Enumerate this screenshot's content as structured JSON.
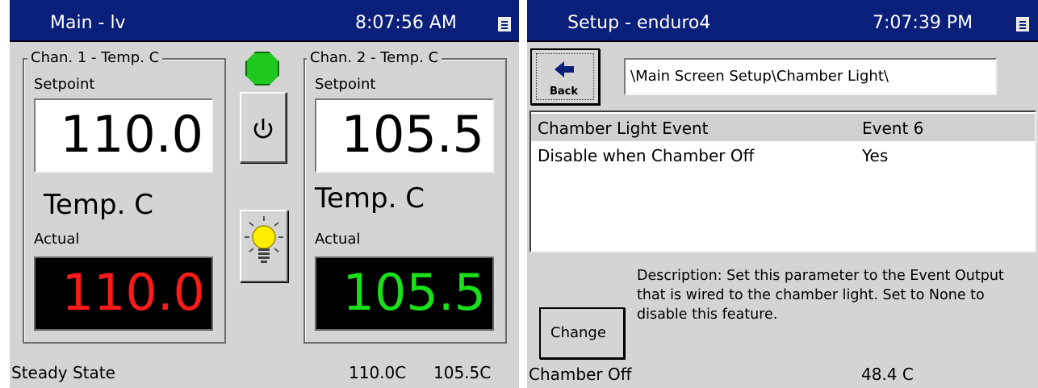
{
  "left_window": {
    "title": "Main - lv",
    "time": "8:07:56 AM",
    "menu_icon": "menu-list-icon",
    "channel1": {
      "group_label": "Chan. 1 - Temp. C",
      "setpoint_label": "Setpoint",
      "setpoint_value": "110.0",
      "units": "Temp. C",
      "actual_label": "Actual",
      "actual_value": "110.0",
      "actual_color": "#ff1a1a"
    },
    "channel2": {
      "group_label": "Chan. 2 - Temp. C",
      "setpoint_label": "Setpoint",
      "setpoint_value": "105.5",
      "units": "Temp. C",
      "actual_label": "Actual",
      "actual_value": "105.5",
      "actual_color": "#19e019"
    },
    "status_indicator_color": "#1ec81e",
    "power_icon": "power-icon",
    "light_icon": "light-bulb-icon",
    "status_bar": {
      "state": "Steady State",
      "chan1": "110.0C",
      "chan2": "105.5C"
    }
  },
  "right_window": {
    "title": "Setup - enduro4",
    "time": "7:07:39 PM",
    "menu_icon": "menu-list-icon",
    "back_button_label": "Back",
    "back_icon": "left-arrow-icon",
    "path": "\\Main Screen Setup\\Chamber Light\\",
    "list": [
      {
        "name": "Chamber Light Event",
        "value": "Event 6"
      },
      {
        "name": "Disable when Chamber Off",
        "value": "Yes"
      }
    ],
    "description": "Description:  Set this parameter to the Event Output that is wired to the chamber light.  Set to None to disable this feature.",
    "change_button_label": "Change",
    "status_bar": {
      "state": "Chamber Off",
      "temp": "48.4 C"
    }
  },
  "colors": {
    "titlebar": "#0a1f7a",
    "panel_bg": "#d4d4d4",
    "list_selected": "#d0d0d0"
  }
}
